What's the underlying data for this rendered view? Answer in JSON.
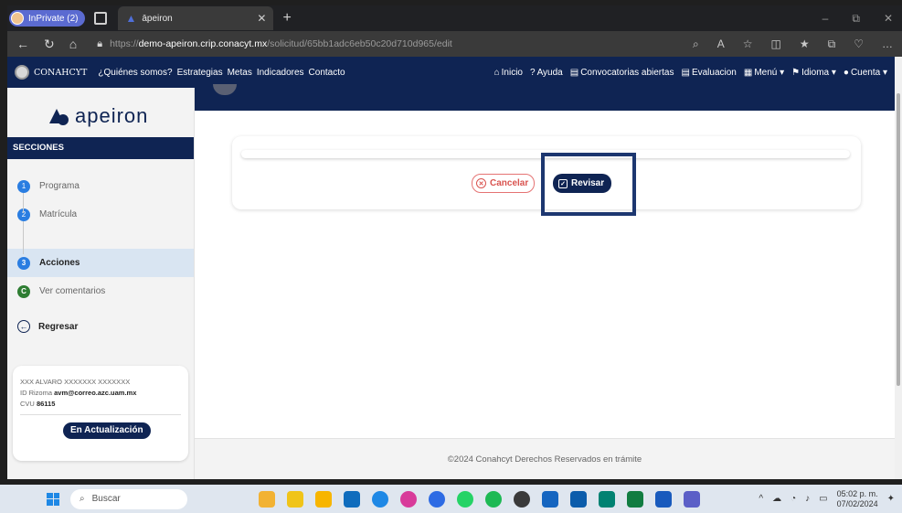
{
  "browser": {
    "profile_label": "InPrivate (2)",
    "tab_title": "āpeiron",
    "url_prefix": "https://",
    "url_domain": "demo-apeiron.crip.conacyt.mx",
    "url_path": "/solicitud/65bb1adc6eb50c20d710d965/edit"
  },
  "sitenav": {
    "logo": "CONAHCYT",
    "left_links": [
      "¿Quiénes somos?",
      "Estrategias",
      "Metas",
      "Indicadores",
      "Contacto"
    ],
    "right_links": {
      "inicio": "Inicio",
      "ayuda": "Ayuda",
      "convocatorias": "Convocatorias abiertas",
      "evaluacion": "Evaluacion",
      "menu": "Menú ▾",
      "idioma": "Idioma ▾",
      "cuenta": "Cuenta ▾"
    }
  },
  "sidebar": {
    "brand": "apeiron",
    "section_title": "SECCIONES",
    "steps": [
      {
        "num": "1",
        "label": "Programa"
      },
      {
        "num": "2",
        "label": "Matrícula"
      },
      {
        "num": "3",
        "label": "Acciones"
      },
      {
        "num": "C",
        "label": "Ver comentarios"
      }
    ],
    "back_label": "Regresar",
    "user": {
      "name": "XXX ALVARO XXXXXXX XXXXXXX",
      "id_label": "ID Rizoma",
      "id_value": "avm@correo.azc.uam.mx",
      "cvu_label": "CVU",
      "cvu_value": "86115",
      "status": "En Actualización"
    }
  },
  "main": {
    "cancel_label": "Cancelar",
    "revisar_label": "Revisar",
    "footer": "©2024 Conahcyt Derechos Reservados en trámite"
  },
  "taskbar": {
    "search_placeholder": "Buscar",
    "time": "05:02 p. m.",
    "date": "07/02/2024"
  },
  "colors": {
    "brand_navy": "#0f2453",
    "step_blue": "#2a7de1",
    "step_green": "#2e7d32",
    "cancel_red": "#d9534f"
  }
}
